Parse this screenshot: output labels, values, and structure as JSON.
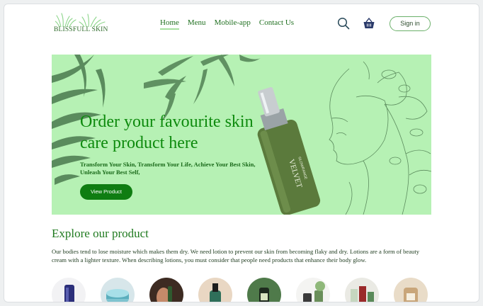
{
  "brand": {
    "name": "BLISSFULL SKIN"
  },
  "nav": {
    "items": [
      {
        "label": "Home",
        "active": true
      },
      {
        "label": "Menu",
        "active": false
      },
      {
        "label": "Mobile-app",
        "active": false
      },
      {
        "label": "Contact Us",
        "active": false
      }
    ]
  },
  "header": {
    "search_icon": "search-icon",
    "basket_icon": "basket-icon",
    "signin_label": "Sign in"
  },
  "hero": {
    "title": "Order your favourite skin care product here",
    "subtitle": "Transform Your Skin, Transform Your Life, Achieve Your Best Skin, Unleash Your Best Self,",
    "button_label": "View Product",
    "bottle_label": "VELVET",
    "bottle_sublabel": "GLOWRANGE",
    "background": "#b6f1b4"
  },
  "explore": {
    "title": "Explore our product",
    "description": "Our bodies tend to lose moisture which makes them dry. We need lotion to prevent our skin from becoming flaky and dry. Lotions are a form of beauty cream with a lighter texture. When describing lotions, you must consider that people need products that enhance their body glow.",
    "products": [
      {
        "name": "product-1"
      },
      {
        "name": "product-2"
      },
      {
        "name": "product-3"
      },
      {
        "name": "product-4"
      },
      {
        "name": "product-5"
      },
      {
        "name": "product-6"
      },
      {
        "name": "product-7"
      },
      {
        "name": "product-8"
      }
    ]
  },
  "colors": {
    "accent": "#0f7d12",
    "text_green": "#0d8a0d",
    "hero_bg": "#b6f1b4"
  }
}
